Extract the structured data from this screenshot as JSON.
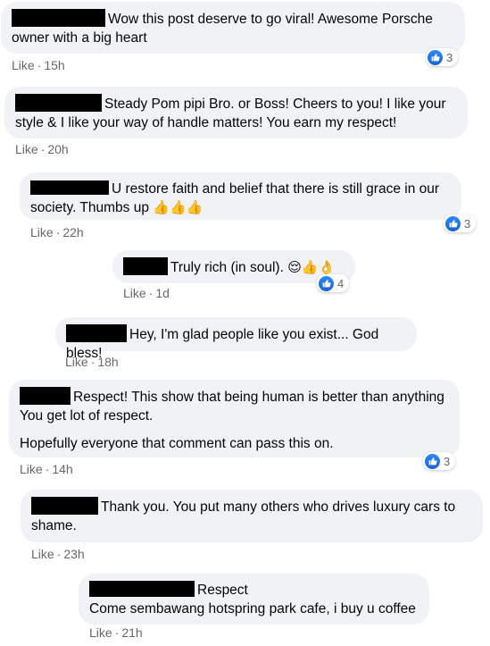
{
  "comments": [
    {
      "text": "Wow this post deserve to go viral! Awesome Porsche owner with a big heart",
      "action": "Like",
      "time": "15h",
      "reactions": "3"
    },
    {
      "text": "Steady Pom pipi Bro. or Boss! Cheers to you! I like your style & I like your way of handle matters! You earn my respect!",
      "action": "Like",
      "time": "20h"
    },
    {
      "text": "U restore faith and belief that there is still grace in our society. Thumbs up",
      "emojis": "👍👍👍",
      "action": "Like",
      "time": "22h",
      "reactions": "3"
    },
    {
      "text": "Truly rich (in soul).",
      "emojis": "😌👍👌",
      "action": "Like",
      "time": "1d",
      "reactions": "4"
    },
    {
      "text": "Hey, I'm glad people like you exist... God bless!",
      "action": "Like",
      "time": "18h"
    },
    {
      "text": "Respect! This show that being human is better than anything You get lot of respect.",
      "text2": "Hopefully everyone that comment can pass this on.",
      "action": "Like",
      "time": "14h",
      "reactions": "3"
    },
    {
      "text": "Thank you. You put many others who drives luxury cars to shame.",
      "action": "Like",
      "time": "23h"
    },
    {
      "text": "Respect",
      "text2": "Come sembawang hotspring park cafe, i buy u coffee",
      "action": "Like",
      "time": "21h"
    }
  ],
  "icons": {
    "like_reaction": "thumbs-up-icon"
  },
  "colors": {
    "bubble": "#f0f2f5",
    "meta": "#65676b",
    "like_blue": "#1877f2"
  }
}
